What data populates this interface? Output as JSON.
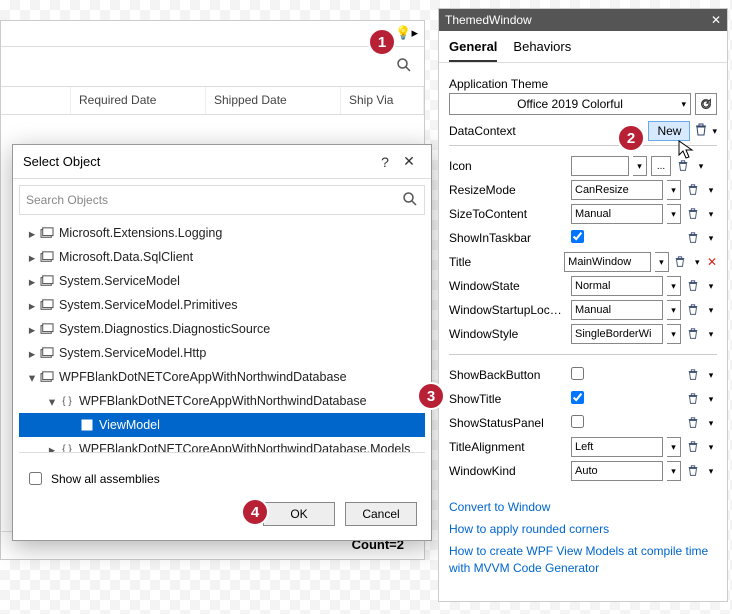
{
  "grid": {
    "cols": [
      "Required Date",
      "Shipped Date",
      "Ship Via"
    ],
    "footer": "Count=2"
  },
  "dialog": {
    "title": "Select Object",
    "search_placeholder": "Search Objects",
    "tree": [
      {
        "level": 0,
        "expand": "closed",
        "icon": "asm",
        "label": "Microsoft.Extensions.Logging"
      },
      {
        "level": 0,
        "expand": "closed",
        "icon": "asm",
        "label": "Microsoft.Data.SqlClient"
      },
      {
        "level": 0,
        "expand": "closed",
        "icon": "asm",
        "label": "System.ServiceModel"
      },
      {
        "level": 0,
        "expand": "closed",
        "icon": "asm",
        "label": "System.ServiceModel.Primitives"
      },
      {
        "level": 0,
        "expand": "closed",
        "icon": "asm",
        "label": "System.Diagnostics.DiagnosticSource"
      },
      {
        "level": 0,
        "expand": "closed",
        "icon": "asm",
        "label": "System.ServiceModel.Http"
      },
      {
        "level": 0,
        "expand": "open",
        "icon": "asm",
        "label": "WPFBlankDotNETCoreAppWithNorthwindDatabase"
      },
      {
        "level": 1,
        "expand": "open",
        "icon": "ns",
        "label": "WPFBlankDotNETCoreAppWithNorthwindDatabase"
      },
      {
        "level": 2,
        "expand": "none",
        "icon": "cls",
        "label": "ViewModel",
        "selected": true
      },
      {
        "level": 1,
        "expand": "closed",
        "icon": "ns",
        "label": "WPFBlankDotNETCoreAppWithNorthwindDatabase.Models"
      }
    ],
    "show_all": "Show all assemblies",
    "ok": "OK",
    "cancel": "Cancel"
  },
  "panel": {
    "title": "ThemedWindow",
    "tabs": [
      "General",
      "Behaviors"
    ],
    "app_theme_label": "Application Theme",
    "app_theme_value": "Office 2019 Colorful",
    "dc_label": "DataContext",
    "new_label": "New",
    "props": [
      {
        "label": "Icon",
        "value": "",
        "type": "withEllipsis"
      },
      {
        "label": "ResizeMode",
        "value": "CanResize",
        "type": "dropdown"
      },
      {
        "label": "SizeToContent",
        "value": "Manual",
        "type": "dropdown"
      },
      {
        "label": "ShowInTaskbar",
        "value": true,
        "type": "check"
      },
      {
        "label": "Title",
        "value": "MainWindow",
        "type": "text",
        "hasX": true
      },
      {
        "label": "WindowState",
        "value": "Normal",
        "type": "dropdown"
      },
      {
        "label": "WindowStartupLocat...",
        "value": "Manual",
        "type": "dropdown"
      },
      {
        "label": "WindowStyle",
        "value": "SingleBorderWi",
        "type": "dropdown"
      }
    ],
    "props2": [
      {
        "label": "ShowBackButton",
        "value": false,
        "type": "check"
      },
      {
        "label": "ShowTitle",
        "value": true,
        "type": "check"
      },
      {
        "label": "ShowStatusPanel",
        "value": false,
        "type": "check"
      },
      {
        "label": "TitleAlignment",
        "value": "Left",
        "type": "dropdown"
      },
      {
        "label": "WindowKind",
        "value": "Auto",
        "type": "dropdown"
      }
    ],
    "links": [
      "Convert to Window",
      "How to apply rounded corners",
      "How to create WPF View Models at compile time with MVVM Code Generator"
    ]
  },
  "badges": [
    "1",
    "2",
    "3",
    "4"
  ]
}
